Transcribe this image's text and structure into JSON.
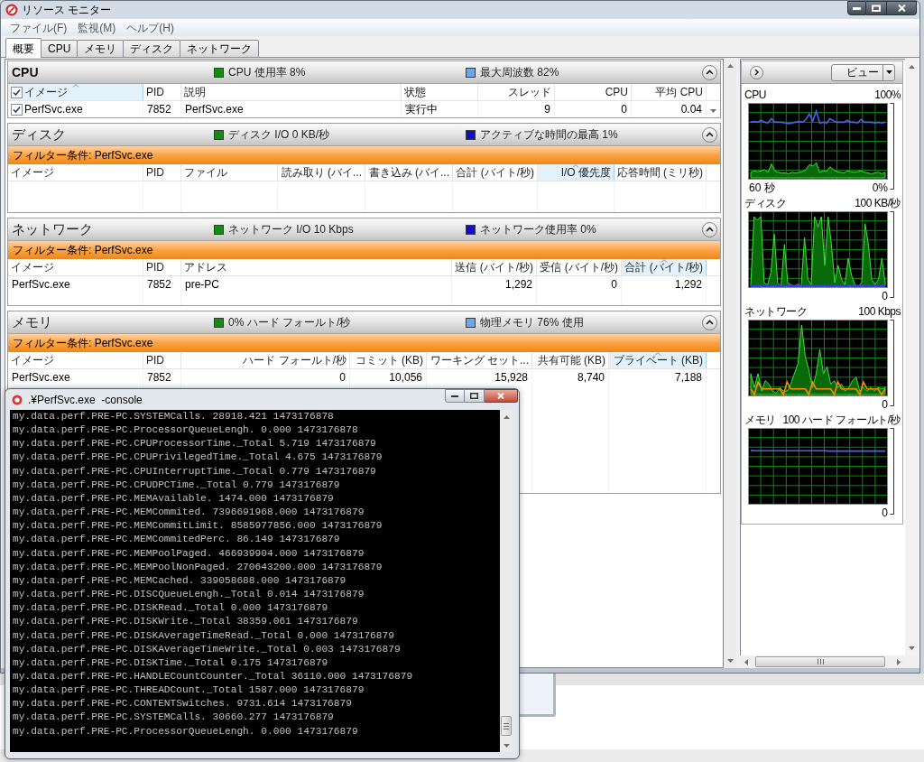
{
  "window": {
    "title": "リソース モニター"
  },
  "menu": [
    {
      "label": "ファイル(F)"
    },
    {
      "label": "監視(M)"
    },
    {
      "label": "ヘルプ(H)"
    }
  ],
  "tabs": [
    {
      "label": "概要",
      "selected": true
    },
    {
      "label": "CPU",
      "selected": false
    },
    {
      "label": "メモリ",
      "selected": false
    },
    {
      "label": "ディスク",
      "selected": false
    },
    {
      "label": "ネットワーク",
      "selected": false
    }
  ],
  "sections": [
    {
      "kind": "cpu",
      "title": "CPU",
      "expanded": true,
      "legend": [
        {
          "text": "CPU 使用率 8%",
          "color": "#148c14"
        },
        {
          "text": "最大周波数 82%",
          "color": "#6aa8ee"
        }
      ],
      "table": {
        "kind": "checklist",
        "all_checked": true,
        "columns": [
          {
            "label": "イメージ",
            "kind": "text",
            "sorted": true
          },
          {
            "label": "PID",
            "kind": "text",
            "sorted": false
          },
          {
            "label": "説明",
            "kind": "text",
            "sorted": false
          },
          {
            "label": "状態",
            "kind": "text",
            "sorted": false
          },
          {
            "label": "スレッド",
            "kind": "number",
            "sorted": false
          },
          {
            "label": "CPU",
            "kind": "number",
            "sorted": false
          },
          {
            "label": "平均 CPU",
            "kind": "number",
            "sorted": false
          }
        ],
        "rows": [
          {
            "checked": true,
            "cells": [
              "PerfSvc.exe",
              "7852",
              "PerfSvc.exe",
              "実行中",
              "9",
              "0",
              "0.04"
            ]
          }
        ]
      }
    },
    {
      "kind": "disk",
      "title": "ディスク",
      "expanded": true,
      "legend": [
        {
          "text": "ディスク I/O 0 KB/秒",
          "color": "#148c14"
        },
        {
          "text": "アクティブな時間の最高 1%",
          "color": "#1010c8"
        }
      ],
      "filter": "フィルター条件: PerfSvc.exe",
      "table": {
        "kind": "plain",
        "columns": [
          {
            "label": "イメージ",
            "kind": "text",
            "sorted": false
          },
          {
            "label": "PID",
            "kind": "text",
            "sorted": false
          },
          {
            "label": "ファイル",
            "kind": "text",
            "sorted": false
          },
          {
            "label": "読み取り (バイ...",
            "kind": "number",
            "sorted": false
          },
          {
            "label": "書き込み (バイ...",
            "kind": "number",
            "sorted": false
          },
          {
            "label": "合計 (バイト/秒)",
            "kind": "number",
            "sorted": false
          },
          {
            "label": "I/O 優先度",
            "kind": "number",
            "sorted": true
          },
          {
            "label": "応答時間 (ミリ秒)",
            "kind": "number",
            "sorted": false
          }
        ]
      }
    },
    {
      "kind": "network",
      "title": "ネットワーク",
      "expanded": true,
      "legend": [
        {
          "text": "ネットワーク I/O 10 Kbps",
          "color": "#148c14"
        },
        {
          "text": "ネットワーク使用率 0%",
          "color": "#1010c8"
        }
      ],
      "filter": "フィルター条件: PerfSvc.exe",
      "table": {
        "kind": "plain",
        "columns": [
          {
            "label": "イメージ",
            "kind": "text",
            "sorted": false
          },
          {
            "label": "PID",
            "kind": "text",
            "sorted": false
          },
          {
            "label": "アドレス",
            "kind": "text",
            "sorted": false
          },
          {
            "label": "送信 (バイト/秒)",
            "kind": "number",
            "sorted": false
          },
          {
            "label": "受信 (バイト/秒)",
            "kind": "number",
            "sorted": false
          },
          {
            "label": "合計 (バイト/秒)",
            "kind": "number",
            "sorted": true
          }
        ],
        "rows": [
          {
            "cells": [
              "PerfSvc.exe",
              "7852",
              "pre-PC",
              "1,292",
              "0",
              "1,292"
            ]
          }
        ]
      }
    },
    {
      "kind": "memory",
      "title": "メモリ",
      "expanded": true,
      "legend": [
        {
          "text": "0% ハード フォールト/秒",
          "color": "#148c14"
        },
        {
          "text": "物理メモリ 76% 使用",
          "color": "#6aa8ee"
        }
      ],
      "filter": "フィルター条件: PerfSvc.exe",
      "table": {
        "kind": "plain",
        "columns": [
          {
            "label": "イメージ",
            "kind": "text",
            "sorted": false
          },
          {
            "label": "PID",
            "kind": "text",
            "sorted": false
          },
          {
            "label": "ハード フォールト/秒",
            "kind": "number",
            "sorted": false
          },
          {
            "label": "コミット (KB)",
            "kind": "number",
            "sorted": false
          },
          {
            "label": "ワーキング セット...",
            "kind": "number",
            "sorted": false
          },
          {
            "label": "共有可能 (KB)",
            "kind": "number",
            "sorted": false
          },
          {
            "label": "プライベート (KB)",
            "kind": "number",
            "sorted": true
          }
        ],
        "rows": [
          {
            "cells": [
              "PerfSvc.exe",
              "7852",
              "0",
              "10,056",
              "15,928",
              "8,740",
              "7,188"
            ]
          }
        ]
      }
    }
  ],
  "graph_panel": {
    "view_button": "ビュー",
    "graphs": [
      {
        "kind": "cpu",
        "title": "CPU",
        "max": "100%",
        "time": "60 秒",
        "min": "0%"
      },
      {
        "kind": "disk",
        "title": "ディスク",
        "max": "100 KB/秒",
        "min": "0"
      },
      {
        "kind": "network",
        "title": "ネットワーク",
        "max": "100 Kbps",
        "min": "0"
      },
      {
        "kind": "memory",
        "title": "メモリ",
        "max": "100 ハード フォールト/秒",
        "min": "0"
      }
    ]
  },
  "console": {
    "title": ".¥PerfSvc.exe  -console",
    "lines": [
      "my.data.perf.PRE-PC.SYSTEMCalls. 28918.421 1473176878",
      "my.data.perf.PRE-PC.ProcessorQueueLengh. 0.000 1473176878",
      "my.data.perf.PRE-PC.CPUProcessorTime._Total 5.719 1473176879",
      "my.data.perf.PRE-PC.CPUPrivilegedTime._Total 4.675 1473176879",
      "my.data.perf.PRE-PC.CPUInterruptTime._Total 0.779 1473176879",
      "my.data.perf.PRE-PC.CPUDPCTime._Total 0.779 1473176879",
      "my.data.perf.PRE-PC.MEMAvailable. 1474.000 1473176879",
      "my.data.perf.PRE-PC.MEMCommited. 7396691968.000 1473176879",
      "my.data.perf.PRE-PC.MEMCommitLimit. 8585977856.000 1473176879",
      "my.data.perf.PRE-PC.MEMCommitedPerc. 86.149 1473176879",
      "my.data.perf.PRE-PC.MEMPoolPaged. 466939904.000 1473176879",
      "my.data.perf.PRE-PC.MEMPoolNonPaged. 270643200.000 1473176879",
      "my.data.perf.PRE-PC.MEMCached. 339058688.000 1473176879",
      "my.data.perf.PRE-PC.DISCQueueLengh._Total 0.014 1473176879",
      "my.data.perf.PRE-PC.DISKRead._Total 0.000 1473176879",
      "my.data.perf.PRE-PC.DISKWrite._Total 38359.061 1473176879",
      "my.data.perf.PRE-PC.DISKAverageTimeRead._Total 0.000 1473176879",
      "my.data.perf.PRE-PC.DISKAverageTimeWrite._Total 0.003 1473176879",
      "my.data.perf.PRE-PC.DISKTime._Total 0.175 1473176879",
      "my.data.perf.PRE-PC.HANDLECountCounter._Total 36110.000 1473176879",
      "my.data.perf.PRE-PC.THREADCount._Total 1587.000 1473176879",
      "my.data.perf.PRE-PC.CONTENTSwitches. 9731.614 1473176879",
      "my.data.perf.PRE-PC.SYSTEMCalls. 30660.277 1473176879",
      "my.data.perf.PRE-PC.ProcessorQueueLengh. 0.000 1473176879"
    ]
  }
}
